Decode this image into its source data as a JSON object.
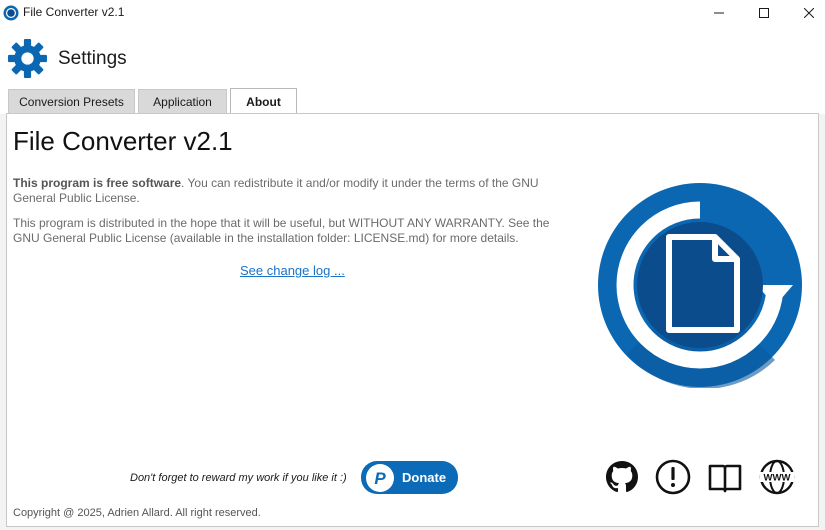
{
  "window": {
    "title": "File Converter v2.1",
    "controls": [
      "minimize",
      "maximize",
      "close"
    ]
  },
  "header": {
    "title": "Settings",
    "icon": "gear-icon"
  },
  "tabs": [
    {
      "label": "Conversion Presets",
      "active": false
    },
    {
      "label": "Application",
      "active": false
    },
    {
      "label": "About",
      "active": true
    }
  ],
  "about": {
    "title": "File Converter v2.1",
    "free_software_bold": "This program is free software",
    "free_software_rest": ". You can redistribute it and/or modify it under the terms of the GNU General Public License.",
    "warranty": "This program is distributed in the hope that it will be useful, but WITHOUT ANY WARRANTY. See the GNU General Public License (available in the installation folder: LICENSE.md) for more details.",
    "changelog_link": "See change log ...",
    "reward_text": "Don't forget to reward my work if you like it :)",
    "donate_label": "Donate",
    "copyright": "Copyright @ 2025, Adrien Allard. All right reserved."
  },
  "footer_icons": [
    "github-icon",
    "issue-icon",
    "documentation-icon",
    "website-icon"
  ],
  "colors": {
    "accent": "#0c6bb8",
    "logo_outer": "#0b67b2",
    "logo_inner": "#0b4d8c",
    "link": "#1a73c6"
  }
}
